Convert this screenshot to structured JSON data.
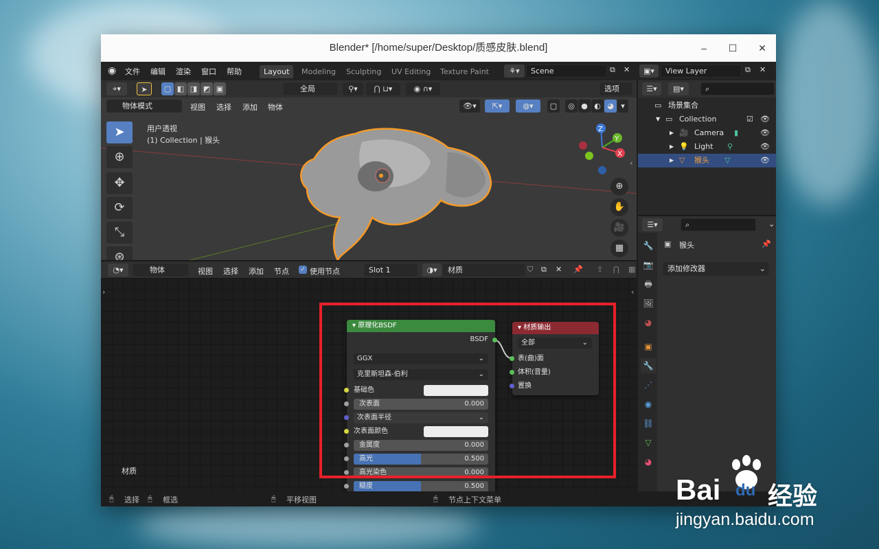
{
  "window": {
    "title": "Blender* [/home/super/Desktop/质感皮肤.blend]",
    "minimize": "–",
    "maximize": "☐",
    "close": "✕"
  },
  "menus": [
    "文件",
    "编辑",
    "渲染",
    "窗口",
    "帮助"
  ],
  "workspaces": [
    "Layout",
    "Modeling",
    "Sculpting",
    "UV Editing",
    "Texture Paint"
  ],
  "scene": "Scene",
  "view_layer": "View Layer",
  "viewport_toolbar": {
    "transform": "全局",
    "options": "选项"
  },
  "viewport_header": {
    "mode": "物体模式",
    "menus": [
      "视图",
      "选择",
      "添加",
      "物体"
    ]
  },
  "viewport": {
    "view_name": "用户透视",
    "collection_info": "(1) Collection | 猴头"
  },
  "gizmo": {
    "z": "Z",
    "y": "Y",
    "x": "X"
  },
  "node_header": {
    "type": "物体",
    "menus": [
      "视图",
      "选择",
      "添加",
      "节点"
    ],
    "use_nodes": "使用节点",
    "slot": "Slot 1",
    "material": "材质"
  },
  "node_editor": {
    "sidebar_label": "材质"
  },
  "bsdf_node": {
    "title": "原理化BSDF",
    "output": "BSDF",
    "distribution": "GGX",
    "subsurface_method": "克里斯坦森-伯利",
    "rows": [
      {
        "label": "基础色",
        "type": "color"
      },
      {
        "label": "次表面",
        "value": "0.000",
        "type": "slider"
      },
      {
        "label": "次表面半径",
        "type": "dropdown"
      },
      {
        "label": "次表面颜色",
        "type": "color"
      },
      {
        "label": "金属度",
        "value": "0.000",
        "type": "slider"
      },
      {
        "label": "高光",
        "value": "0.500",
        "type": "slider",
        "fill": 0.5
      },
      {
        "label": "高光染色",
        "value": "0.000",
        "type": "slider"
      },
      {
        "label": "糙度",
        "value": "0.500",
        "type": "slider",
        "fill": 0.5
      }
    ]
  },
  "output_node": {
    "title": "材质输出",
    "target": "全部",
    "inputs": [
      "表(曲)面",
      "体积(音量)",
      "置换"
    ]
  },
  "outliner": {
    "root": "场景集合",
    "collection": "Collection",
    "items": [
      "Camera",
      "Light",
      "猴头"
    ]
  },
  "properties": {
    "object_name": "猴头",
    "add_modifier": "添加修改器"
  },
  "statusbar": {
    "select": "选择",
    "box_select": "框选",
    "pan": "平移视图",
    "context_menu": "节点上下文菜单"
  },
  "watermark": {
    "brand_left": "Bai",
    "brand_right": "du",
    "brand_cn": "经验",
    "url": "jingyan.baidu.com"
  },
  "colors": {
    "accent_blue": "#5680c2",
    "bsdf_header": "#3b8a3e",
    "output_header": "#8c2a32",
    "selection_orange": "#f39a2a",
    "highlight_red": "#e8202a"
  }
}
